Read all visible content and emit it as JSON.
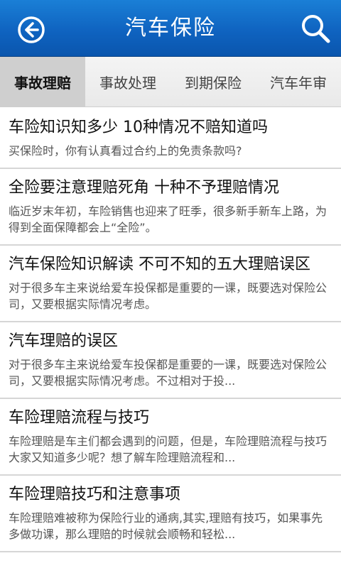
{
  "header": {
    "title": "汽车保险",
    "back_icon": "back-arrow-icon",
    "search_icon": "search-icon",
    "bar_color": "#0f63c0"
  },
  "tabs": [
    {
      "label": "事故理赔",
      "active": true
    },
    {
      "label": "事故处理",
      "active": false
    },
    {
      "label": "到期保险",
      "active": false
    },
    {
      "label": "汽车年审",
      "active": false
    }
  ],
  "articles": [
    {
      "title": "车险知识知多少 10种情况不赔知道吗",
      "summary": "买保险时，你有认真看过合约上的免责条款吗?"
    },
    {
      "title": "全险要注意理赔死角 十种不予理赔情况",
      "summary": "临近岁末年初，车险销售也迎来了旺季，很多新手新车上路，为得到全面保障都会上“全险”。"
    },
    {
      "title": "汽车保险知识解读 不可不知的五大理赔误区",
      "summary": "对于很多车主来说给爱车投保都是重要的一课，既要选对保险公司，又要根据实际情况考虑。"
    },
    {
      "title": "汽车理赔的误区",
      "summary": "对于很多车主来说给爱车投保都是重要的一课，既要选对保险公司，又要根据实际情况考虑。不过相对于投..."
    },
    {
      "title": "车险理赔流程与技巧",
      "summary": "车险理赔是车主们都会遇到的问题，但是，车险理赔流程与技巧大家又知道多少呢？想了解车险理赔流程和..."
    },
    {
      "title": "车险理赔技巧和注意事项",
      "summary": "车险理赔难被称为保险行业的通病,其实,理赔有技巧，如果事先多做功课，那么理赔的时候就会顺畅和轻松..."
    }
  ]
}
